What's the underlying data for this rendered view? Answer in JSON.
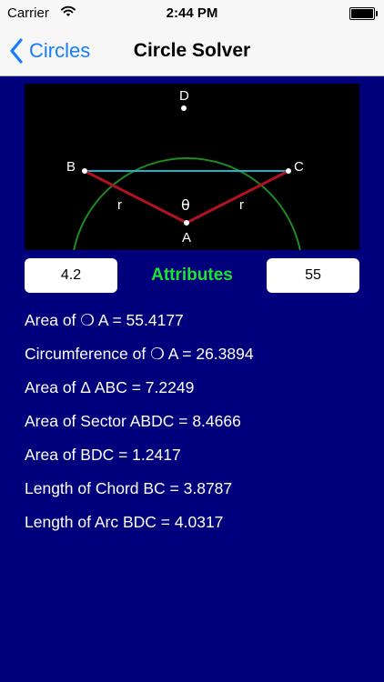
{
  "status_bar": {
    "carrier": "Carrier",
    "time": "2:44 PM",
    "wifi_icon": "wifi-icon",
    "battery_icon": "battery-icon"
  },
  "nav": {
    "back_label": "Circles",
    "back_icon": "chevron-left-icon",
    "title": "Circle Solver"
  },
  "diagram": {
    "labels": {
      "a": "A",
      "b": "B",
      "c": "C",
      "d": "D",
      "r_left": "r",
      "r_right": "r",
      "theta": "θ"
    },
    "colors": {
      "background": "#000000",
      "circle": "#1e8b22",
      "chord": "#20b0c8",
      "radius": "#b01222",
      "text": "#ffffff"
    }
  },
  "inputs": {
    "radius_value": "4.2",
    "angle_value": "55"
  },
  "attributes_label": "Attributes",
  "results": [
    "Area of ❍ A = 55.4177",
    "Circumference of ❍ A = 26.3894",
    "Area of Δ ABC = 7.2249",
    "Area of Sector ABDC = 8.4666",
    "Area of BDC = 1.2417",
    "Length of Chord BC = 3.8787",
    "Length of Arc BDC = 4.0317"
  ],
  "colors": {
    "page_background": "#00007c",
    "accent": "#147efb",
    "attributes_green": "#19e52e"
  }
}
